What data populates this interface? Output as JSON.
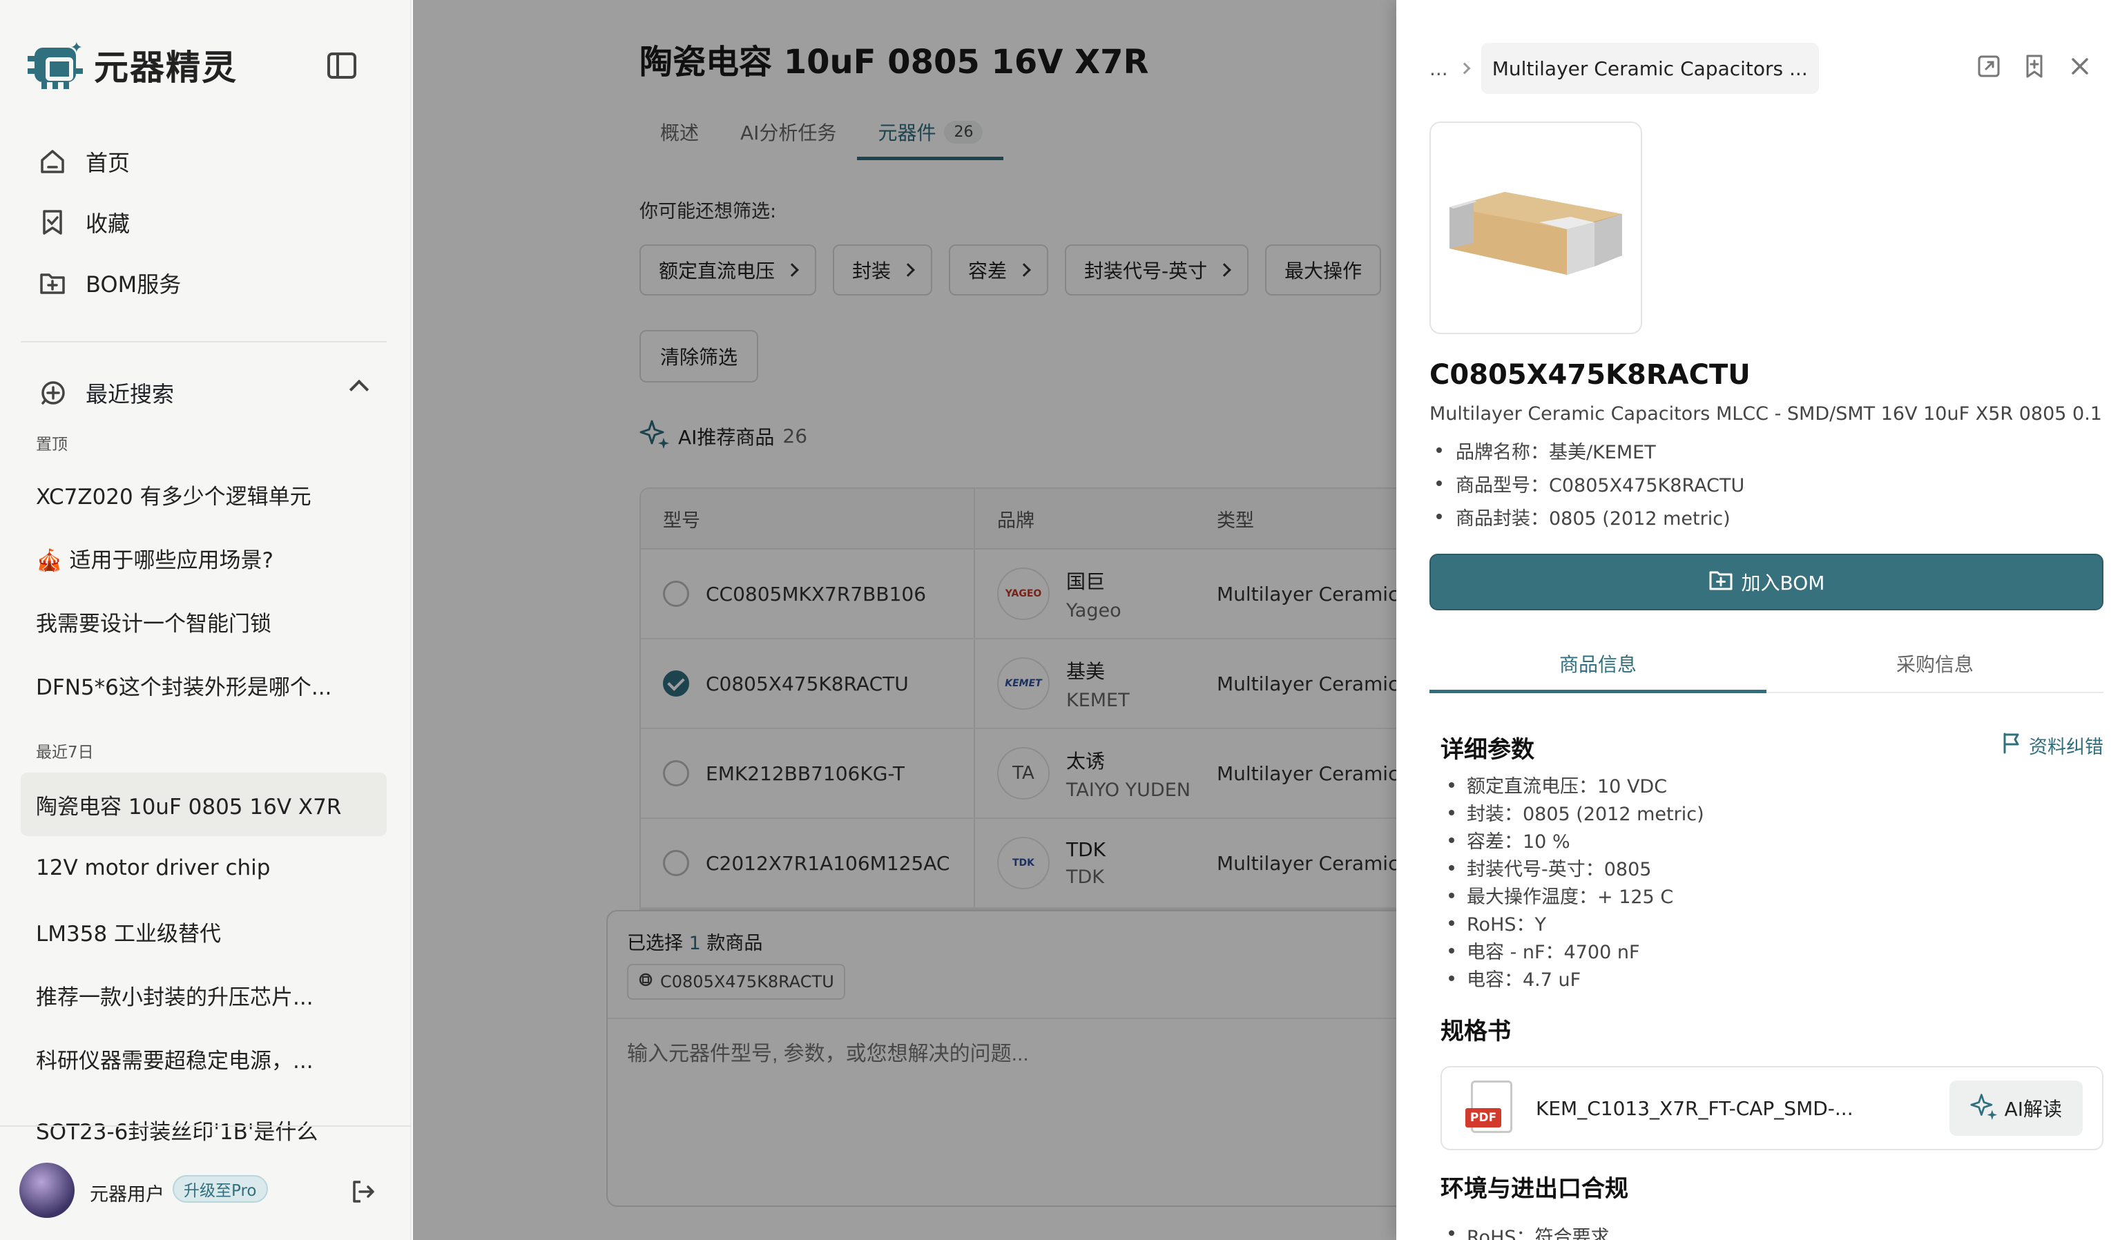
{
  "app": {
    "name": "元器精灵"
  },
  "nav": [
    {
      "label": "首页",
      "icon": "home-icon"
    },
    {
      "label": "收藏",
      "icon": "bookmark-icon"
    },
    {
      "label": "BOM服务",
      "icon": "folder-plus-icon"
    }
  ],
  "recent": {
    "title": "最近搜索",
    "pinned_label": "置顶",
    "pinned": [
      "XC7Z020 有多少个逻辑单元",
      "🎪 适用于哪些应用场景?",
      "我需要设计一个智能门锁",
      "DFN5*6这个封装外形是哪个..."
    ],
    "week_label": "最近7日",
    "week": [
      "陶瓷电容 10uF 0805 16V X7R",
      "12V motor driver chip",
      "LM358 工业级替代",
      "推荐一款小封装的升压芯片...",
      "科研仪器需要超稳定电源，...",
      "SOT23-6封装丝印'1B'是什么"
    ]
  },
  "user": {
    "name": "元器用户",
    "upgrade": "升级至Pro"
  },
  "main": {
    "title": "陶瓷电容 10uF 0805 16V X7R",
    "tabs": [
      {
        "label": "概述"
      },
      {
        "label": "AI分析任务"
      },
      {
        "label": "元器件",
        "count": "26"
      }
    ],
    "filter_hint": "你可能还想筛选:",
    "filters": [
      "额定直流电压",
      "封装",
      "容差",
      "封装代号-英寸",
      "最大操作"
    ],
    "clear": "清除筛选",
    "ai_rec": {
      "label": "AI推荐商品",
      "count": "26"
    },
    "table": {
      "headers": [
        "型号",
        "品牌",
        "类型"
      ],
      "rows": [
        {
          "model": "CC0805MKX7R7BB106",
          "brand_cn": "国巨",
          "brand_en": "Yageo",
          "logo": "YAGEO",
          "type": "Multilayer Ceramic",
          "checked": false
        },
        {
          "model": "C0805X475K8RACTU",
          "brand_cn": "基美",
          "brand_en": "KEMET",
          "logo": "KEMET",
          "type": "Multilayer Ceramic",
          "checked": true
        },
        {
          "model": "EMK212BB7106KG-T",
          "brand_cn": "太诱",
          "brand_en": "TAIYO YUDEN",
          "logo": "TA",
          "type": "Multilayer Ceramic",
          "checked": false
        },
        {
          "model": "C2012X7R1A106M125AC",
          "brand_cn": "TDK",
          "brand_en": "TDK",
          "logo": "TDK",
          "type": "Multilayer Ceramic",
          "checked": false
        }
      ]
    },
    "selection": {
      "prefix": "已选择 ",
      "count": "1",
      "suffix": " 款商品",
      "chip": "C0805X475K8RACTU",
      "placeholder": "输入元器件型号, 参数，或您想解决的问题..."
    }
  },
  "panel": {
    "breadcrumb_ellipsis": "...",
    "breadcrumb": "Multilayer Ceramic Capacitors ...",
    "part": "C0805X475K8RACTU",
    "description": "Multilayer Ceramic Capacitors MLCC - SMD/SMT 16V 10uF X5R 0805 0.1",
    "meta": [
      "品牌名称：基美/KEMET",
      "商品型号：C0805X475K8RACTU",
      "商品封装：0805 (2012 metric)"
    ],
    "add_bom": "加入BOM",
    "tabs": [
      "商品信息",
      "采购信息"
    ],
    "params_title": "详细参数",
    "correct": "资料纠错",
    "params": [
      "额定直流电压：10 VDC",
      "封装：0805 (2012 metric)",
      "容差：10 %",
      "封装代号-英寸：0805",
      "最大操作温度：+ 125 C",
      "RoHS：Y",
      "电容 - nF：4700 nF",
      "电容：4.7 uF"
    ],
    "datasheet_title": "规格书",
    "datasheet": {
      "badge": "PDF",
      "name": "KEM_C1013_X7R_FT-CAP_SMD-...",
      "ai": "AI解读"
    },
    "env_title": "环境与进出口合规",
    "env_item": "RoHS：符合要求"
  },
  "colors": {
    "accent": "#2f6f7e",
    "bom_button": "#37717d",
    "pdf_red": "#d23b2b"
  }
}
